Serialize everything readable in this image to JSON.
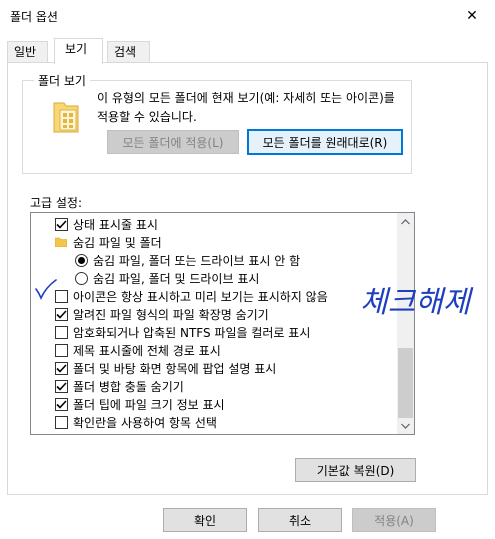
{
  "window": {
    "title": "폴더 옵션",
    "close_label": "✕"
  },
  "tabs": [
    {
      "label": "일반",
      "active": false
    },
    {
      "label": "보기",
      "active": true
    },
    {
      "label": "검색",
      "active": false
    }
  ],
  "folder_view": {
    "legend": "폴더 보기",
    "description": "이 유형의 모든 폴더에 현재 보기(예: 자세히 또는 아이콘)를 적용할 수 있습니다.",
    "apply_button": "모든 폴더에 적용(L)",
    "reset_button": "모든 폴더를 원래대로(R)"
  },
  "advanced": {
    "label": "고급 설정:",
    "items": [
      {
        "type": "check",
        "checked": true,
        "indent": 0,
        "label": "상태 표시줄 표시"
      },
      {
        "type": "folder",
        "indent": 0,
        "label": "숨김 파일 및 폴더"
      },
      {
        "type": "radio",
        "checked": true,
        "indent": 1,
        "label": "숨김 파일, 폴더 또는 드라이브 표시 안 함"
      },
      {
        "type": "radio",
        "checked": false,
        "indent": 1,
        "label": "숨김 파일, 폴더 및 드라이브 표시"
      },
      {
        "type": "check",
        "checked": false,
        "indent": 0,
        "label": "아이콘은 항상 표시하고 미리 보기는 표시하지 않음"
      },
      {
        "type": "check",
        "checked": true,
        "indent": 0,
        "label": "알려진 파일 형식의 파일 확장명 숨기기"
      },
      {
        "type": "check",
        "checked": false,
        "indent": 0,
        "label": "암호화되거나 압축된 NTFS 파일을 컬러로 표시"
      },
      {
        "type": "check",
        "checked": false,
        "indent": 0,
        "label": "제목 표시줄에 전체 경로 표시"
      },
      {
        "type": "check",
        "checked": true,
        "indent": 0,
        "label": "폴더 및 바탕 화면 항목에 팝업 설명 표시"
      },
      {
        "type": "check",
        "checked": true,
        "indent": 0,
        "label": "폴더 병합 충돌 숨기기"
      },
      {
        "type": "check",
        "checked": true,
        "indent": 0,
        "label": "폴더 팁에 파일 크기 정보 표시"
      },
      {
        "type": "check",
        "checked": false,
        "indent": 0,
        "label": "확인란을 사용하여 항목 선택"
      }
    ],
    "restore_button": "기본값 복원(D)"
  },
  "footer": {
    "ok_button": "확인",
    "cancel_button": "취소",
    "apply_button": "적용(A)"
  },
  "annotation": {
    "handwritten_text": "체크해제",
    "ink_color": "#1f3fbf"
  },
  "colors": {
    "accent": "#0078d7",
    "disabled_text": "#838383"
  }
}
